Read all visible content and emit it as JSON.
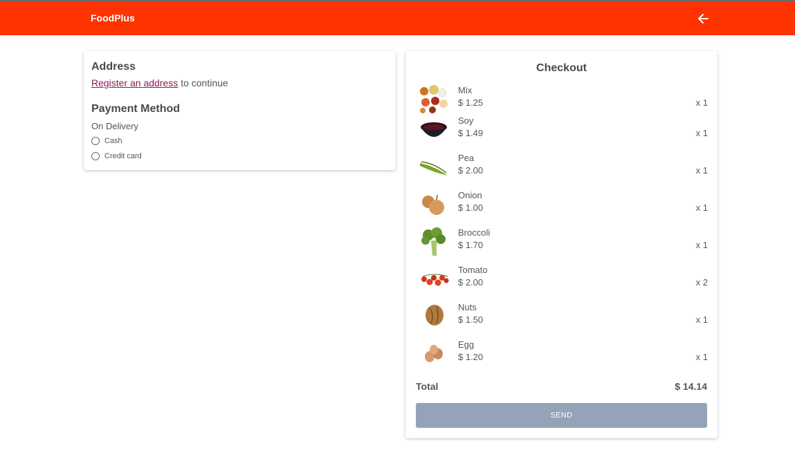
{
  "header": {
    "brand": "FoodPlus",
    "back_icon": "arrow-left-icon"
  },
  "address": {
    "title": "Address",
    "register_link": "Register an address",
    "continue_text": "to continue"
  },
  "payment": {
    "title": "Payment Method",
    "subtitle": "On Delivery",
    "options": [
      "Cash",
      "Credit card"
    ]
  },
  "checkout": {
    "title": "Checkout",
    "items": [
      {
        "name": "Mix",
        "price": "$ 1.25",
        "qty": "x 1",
        "icon": "spice-mix-icon"
      },
      {
        "name": "Soy",
        "price": "$ 1.49",
        "qty": "x 1",
        "icon": "soy-sauce-bowl-icon"
      },
      {
        "name": "Pea",
        "price": "$ 2.00",
        "qty": "x 1",
        "icon": "pea-pod-icon"
      },
      {
        "name": "Onion",
        "price": "$ 1.00",
        "qty": "x 1",
        "icon": "onion-icon"
      },
      {
        "name": "Broccoli",
        "price": "$ 1.70",
        "qty": "x 1",
        "icon": "broccoli-icon"
      },
      {
        "name": "Tomato",
        "price": "$ 2.00",
        "qty": "x 2",
        "icon": "cherry-tomato-icon"
      },
      {
        "name": "Nuts",
        "price": "$ 1.50",
        "qty": "x 1",
        "icon": "walnut-icon"
      },
      {
        "name": "Egg",
        "price": "$ 1.20",
        "qty": "x 1",
        "icon": "egg-icon"
      }
    ],
    "total_label": "Total",
    "total_value": "$ 14.14",
    "send_label": "SEND"
  },
  "colors": {
    "header": "#ff3300",
    "link": "#8a1c55",
    "send_button": "#94a3b8"
  }
}
